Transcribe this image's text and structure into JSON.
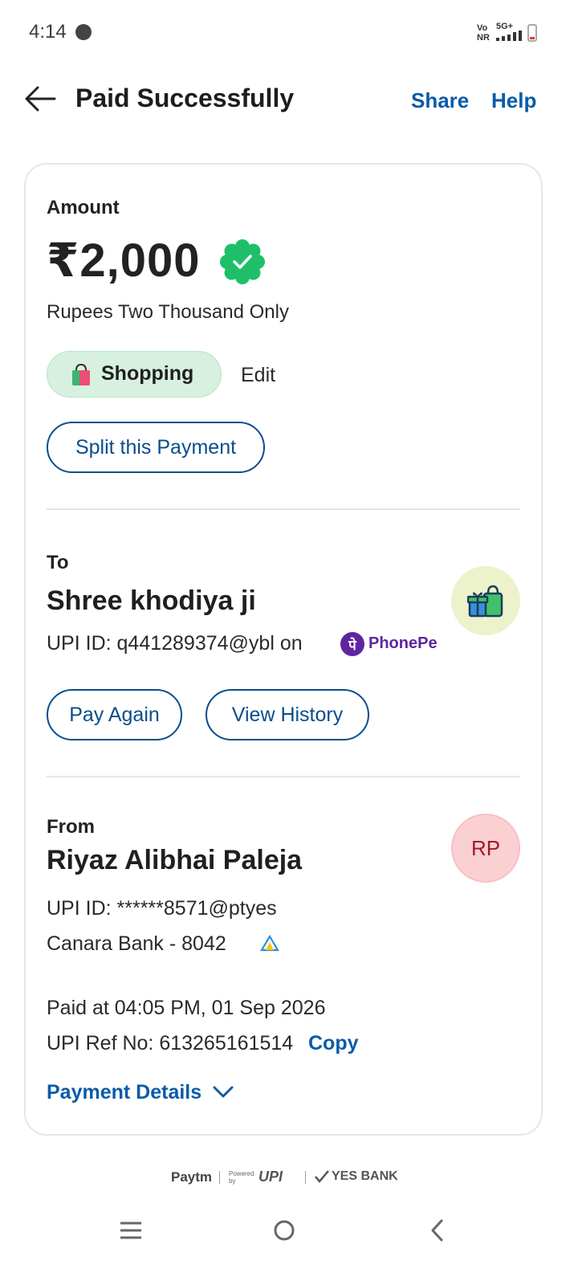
{
  "status_bar": {
    "time": "4:14",
    "network_top": "Vo",
    "network_bottom": "NR",
    "signal": "5G+"
  },
  "header": {
    "title": "Paid Successfully",
    "share_label": "Share",
    "help_label": "Help"
  },
  "amount_section": {
    "label": "Amount",
    "amount": "₹2,000",
    "amount_words": "Rupees Two Thousand Only",
    "category": "Shopping",
    "edit_label": "Edit",
    "split_label": "Split this Payment"
  },
  "to_section": {
    "label": "To",
    "name": "Shree khodiya ji",
    "upi_line": "UPI ID: q441289374@ybl on",
    "app_name": "PhonePe",
    "pay_again_label": "Pay Again",
    "view_history_label": "View History"
  },
  "from_section": {
    "label": "From",
    "name": "Riyaz Alibhai Paleja",
    "initials": "RP",
    "upi_line": "UPI ID: ******8571@ptyes",
    "bank_line": "Canara Bank - 8042"
  },
  "transaction": {
    "paid_at": "Paid at 04:05 PM, 01 Sep 2026",
    "ref_line": "UPI Ref No: 613265161514",
    "copy_label": "Copy",
    "details_label": "Payment Details"
  },
  "footer": {
    "paytm": "Paytm",
    "powered_by": "Powered by",
    "upi": "UPI",
    "bank": "YES BANK"
  },
  "colors": {
    "accent": "#0a5ba8",
    "success": "#1fbf6a",
    "chip_bg": "#d7f0e0",
    "avatar_rp_bg": "#fbd0d3"
  }
}
